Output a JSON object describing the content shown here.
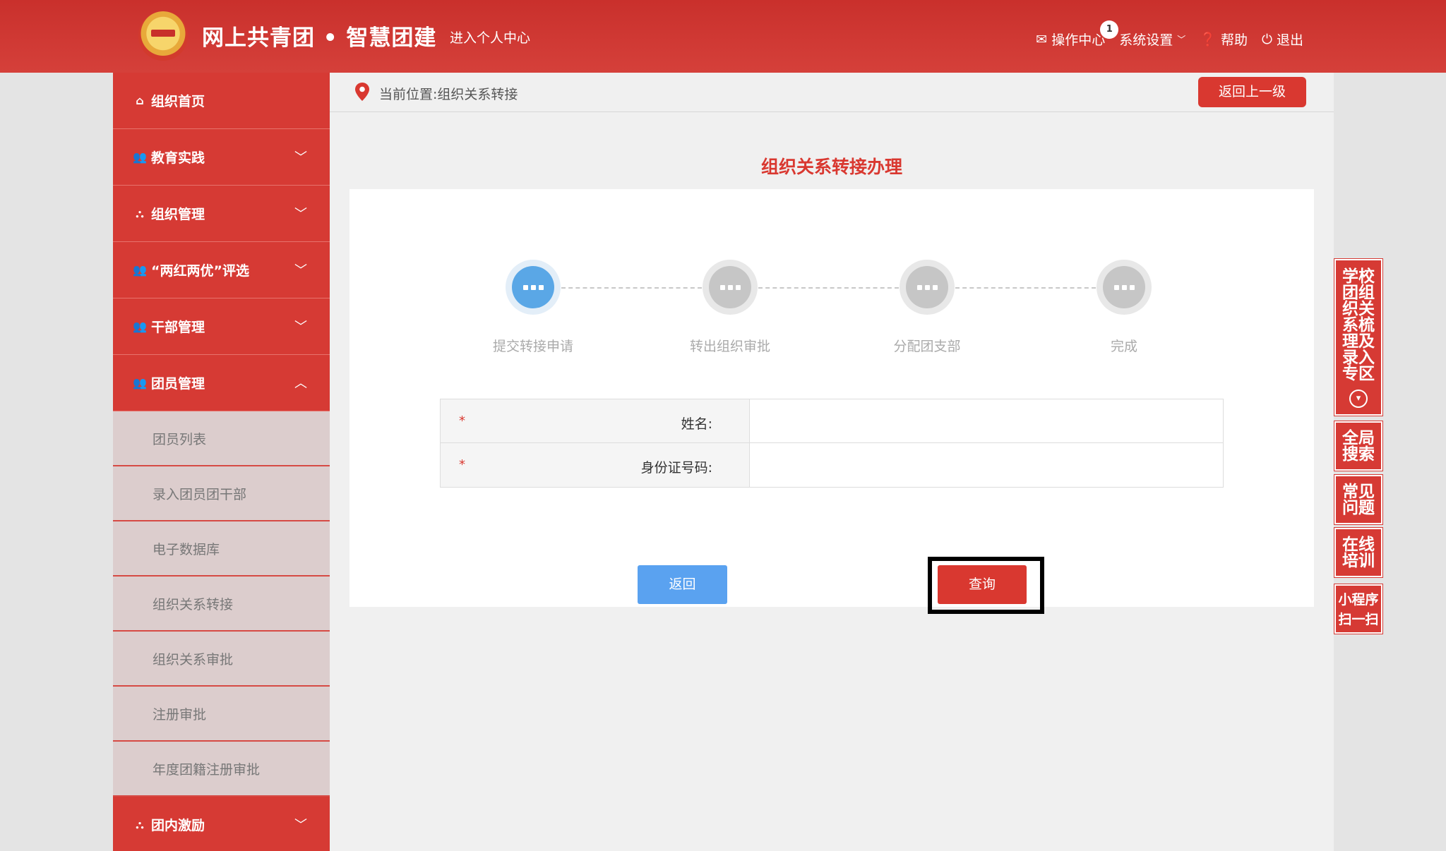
{
  "header": {
    "site_title": "网上共青团 • 智慧团建",
    "personal_center": "进入个人中心",
    "nav": {
      "operation_center": "操作中心",
      "operation_badge": "1",
      "system_settings": "系统设置",
      "help": "帮助",
      "logout": "退出"
    }
  },
  "sidebar": {
    "items": [
      {
        "label": "组织首页",
        "icon": "home-icon"
      },
      {
        "label": "教育实践",
        "icon": "users-icon"
      },
      {
        "label": "组织管理",
        "icon": "sitemap-icon"
      },
      {
        "label": "“两红两优”评选",
        "icon": "users-icon"
      },
      {
        "label": "干部管理",
        "icon": "users-icon"
      },
      {
        "label": "团员管理",
        "icon": "users-icon"
      }
    ],
    "sub_items": [
      "团员列表",
      "录入团员团干部",
      "电子数据库",
      "组织关系转接",
      "组织关系审批",
      "注册审批",
      "年度团籍注册审批"
    ],
    "after_items": [
      {
        "label": "团内激励",
        "icon": "sitemap-icon"
      }
    ]
  },
  "breadcrumb": {
    "text": "当前位置:组织关系转接",
    "back_button": "返回上一级"
  },
  "page_title": "组织关系转接办理",
  "steps": [
    "提交转接申请",
    "转出组织审批",
    "分配团支部",
    "完成"
  ],
  "form": {
    "name_label": "姓名:",
    "id_label": "身份证号码:",
    "required_mark": "*",
    "name_value": "",
    "id_value": ""
  },
  "buttons": {
    "return": "返回",
    "query": "查询"
  },
  "float_tabs": {
    "school": "学校团组织关系梳理及录入专区",
    "search": "全局搜索",
    "faq": "常见问题",
    "training": "在线培训",
    "miniprogram_line1": "小程序",
    "miniprogram_line2": "扫一扫"
  },
  "colors": {
    "brand_red": "#d63a34",
    "active_step": "#5aa7e6",
    "return_button": "#5aa2f0"
  }
}
